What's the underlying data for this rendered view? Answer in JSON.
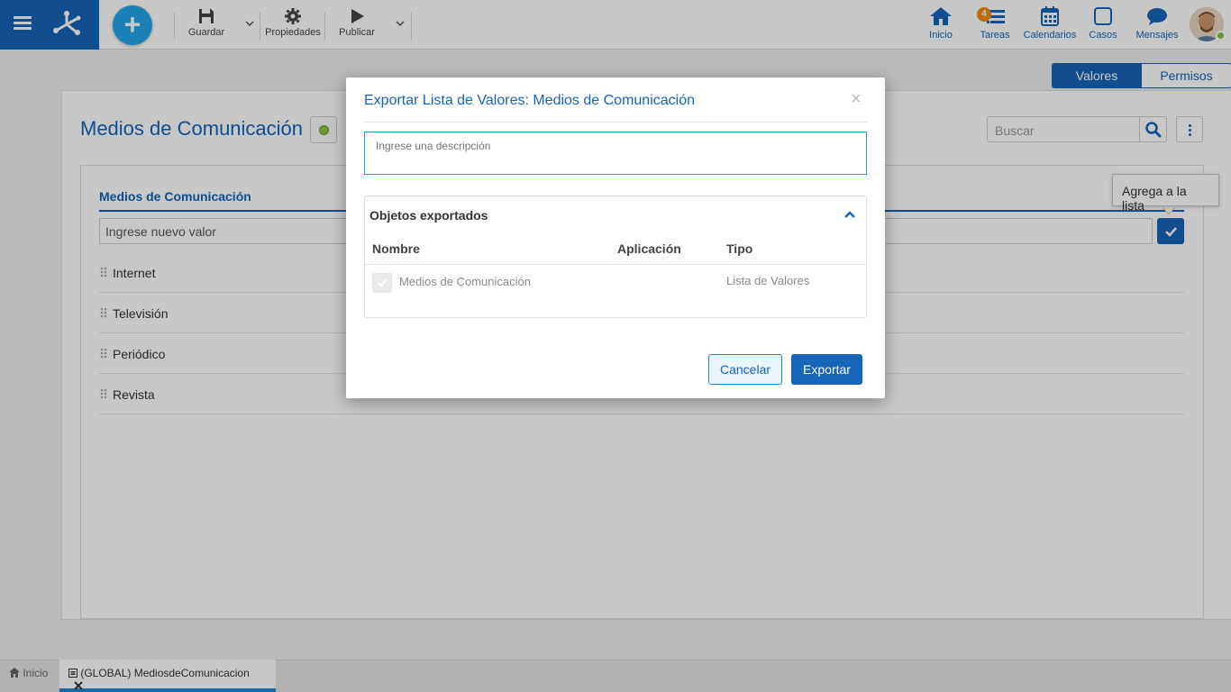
{
  "toolbar": {
    "save_label": "Guardar",
    "properties_label": "Propiedades",
    "publish_label": "Publicar"
  },
  "nav": {
    "home_label": "Inicio",
    "tasks_label": "Tareas",
    "tasks_badge": "4",
    "calendars_label": "Calendarios",
    "cases_label": "Casos",
    "messages_label": "Mensajes"
  },
  "view_tabs": {
    "values_label": "Valores",
    "permissions_label": "Permisos"
  },
  "page": {
    "title": "Medios de Comunicación",
    "search_placeholder": "Buscar",
    "list_header": "Medios de Comunicación",
    "new_value_placeholder": "Ingrese nuevo valor",
    "tooltip": "Agrega a la lista",
    "items": [
      "Internet",
      "Televisión",
      "Periódico",
      "Revista"
    ]
  },
  "bottom_tabs": {
    "home_label": "Inicio",
    "doc_label": "(GLOBAL) MediosdeComunicacion"
  },
  "modal": {
    "title": "Exportar Lista de Valores: Medios de Comunicación",
    "close_glyph": "×",
    "description_placeholder": "Ingrese una descripción",
    "section_title": "Objetos exportados",
    "col_name": "Nombre",
    "col_app": "Aplicación",
    "col_type": "Tipo",
    "row_name": "Medios de Comunicación",
    "row_type": "Lista de Valores",
    "cancel_label": "Cancelar",
    "export_label": "Exportar"
  },
  "colors": {
    "primary": "#1565b8",
    "accent": "#23a6ea",
    "badge": "#f08c0f",
    "status_ok": "#8bc34a"
  }
}
